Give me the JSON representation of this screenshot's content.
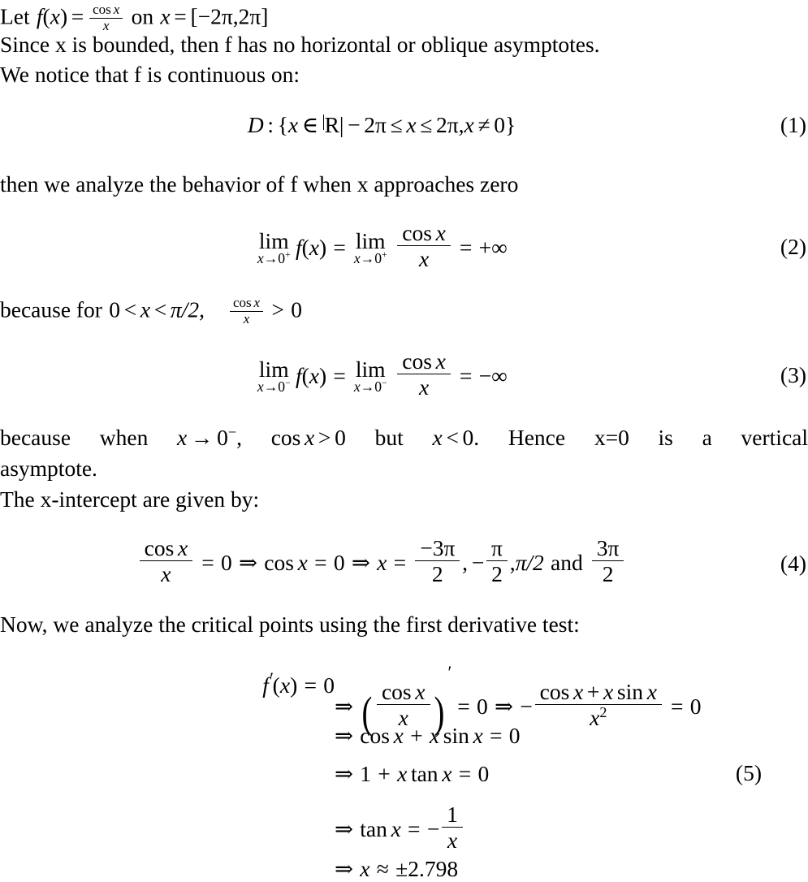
{
  "document": {
    "type": "latex-math-derivation",
    "topic": "Analysis of f(x) = cos(x)/x on [-2pi, 2pi]",
    "background_color": "#ffffff",
    "text_color": "#000000"
  },
  "lines": {
    "intro_let": {
      "prefix": "Let",
      "function_name": "f",
      "paren_open": "(",
      "variable": "x",
      "paren_close": ")",
      "equals": "=",
      "numerator": "cos",
      "num_var": "x",
      "denominator": "x",
      "on": "on",
      "domain_var": "x",
      "domain_equals": "=",
      "interval": "[−2π, 2π]",
      "interval_open": "[",
      "interval_low": "−2π",
      "interval_comma": ",",
      "interval_high": "2π",
      "interval_close": "]"
    },
    "bounded": "Since x is bounded, then f has no horizontal or oblique asymptotes.",
    "continuous": "We notice that f is continuous on:",
    "behavior": "then we analyze the behavior of f when x approaches zero",
    "because_for": {
      "text": "because for",
      "zero": "0",
      "lt1": "<",
      "var": "x",
      "lt2": "<",
      "bound": "π/2,",
      "frac_num_op": "cos",
      "frac_num_var": "x",
      "frac_den": "x",
      "gt": ">",
      "zero2": "0"
    },
    "because_when": {
      "w1": "because",
      "w2": "when",
      "var": "x",
      "arrow": "→",
      "zero_minus_base": "0",
      "zero_minus_sup": "−",
      "comma": ",",
      "cos": "cos",
      "cos_var": "x",
      "gt": ">",
      "zero": "0",
      "but": "but",
      "var2": "x",
      "lt": "<",
      "zero2": "0.",
      "hence": "Hence",
      "xeq0": "x=0",
      "is_a": "is",
      "a": "a",
      "vertical": "vertical"
    },
    "asymptote": "asymptote.",
    "xintercept": "The x-intercept are given by:",
    "critical": "Now, we analyze the critical points using the first derivative test:"
  },
  "equations": [
    {
      "tag": "(1)",
      "id": "domain-set",
      "parts": {
        "D": "D",
        "colon": ":",
        "brace_open": "{",
        "x": "x",
        "in": "∈",
        "reals": "ℝ",
        "bar": "|",
        "minus": "−",
        "two_pi": "2π",
        "le1": "≤",
        "x2": "x",
        "le2": "≤",
        "two_pi2": "2π",
        "comma": ",",
        "x3": "x",
        "neq": "≠",
        "zero": "0",
        "brace_close": "}"
      }
    },
    {
      "tag": "(2)",
      "id": "limit-right",
      "parts": {
        "lim1": "lim",
        "lim1_sub_var": "x",
        "lim1_sub_arrow": "→",
        "lim1_sub_val": "0",
        "lim1_sub_sign": "+",
        "f": "f",
        "fopen": "(",
        "fvar": "x",
        "fclose": ")",
        "eq1": "=",
        "lim2": "lim",
        "lim2_sub_var": "x",
        "lim2_sub_arrow": "→",
        "lim2_sub_val": "0",
        "lim2_sub_sign": "+",
        "num_op": "cos",
        "num_var": "x",
        "den": "x",
        "eq2": "=",
        "result": "+∞"
      }
    },
    {
      "tag": "(3)",
      "id": "limit-left",
      "parts": {
        "lim1": "lim",
        "lim1_sub_var": "x",
        "lim1_sub_arrow": "→",
        "lim1_sub_val": "0",
        "lim1_sub_sign": "−",
        "f": "f",
        "fopen": "(",
        "fvar": "x",
        "fclose": ")",
        "eq1": "=",
        "lim2": "lim",
        "lim2_sub_var": "x",
        "lim2_sub_arrow": "→",
        "lim2_sub_val": "0",
        "lim2_sub_sign": "−",
        "num_op": "cos",
        "num_var": "x",
        "den": "x",
        "eq2": "=",
        "result": "−∞"
      }
    },
    {
      "tag": "(4)",
      "id": "x-intercepts",
      "parts": {
        "num_op": "cos",
        "num_var": "x",
        "den": "x",
        "eq1": "=",
        "zero1": "0",
        "implies1": "⇒",
        "cos": "cos",
        "cos_var": "x",
        "eq2": "=",
        "zero2": "0",
        "implies2": "⇒",
        "x": "x",
        "eq3": "=",
        "r1_num": "−3π",
        "r1_den": "2",
        "comma1": ",",
        "minus": "−",
        "r2_num": "π",
        "r2_den": "2",
        "comma2": ",",
        "r3": "π/2",
        "and": "and",
        "r4_num": "3π",
        "r4_den": "2"
      }
    },
    {
      "tag": "(5)",
      "id": "critical-points",
      "lines": [
        {
          "lhs": {
            "f": "f",
            "prime": "′",
            "open": "(",
            "var": "x",
            "close": ")",
            "eq": "=",
            "zero": "0"
          },
          "rhs": {
            "implies1": "⇒",
            "paren_open": "(",
            "num_op": "cos",
            "num_var": "x",
            "den": "x",
            "paren_close": ")",
            "deriv_prime": "′",
            "eq1": "=",
            "zero1": "0",
            "implies2": "⇒",
            "neg": "−",
            "frac_num": "cos x + x sin x",
            "frac_num_cos": "cos",
            "frac_num_cosvar": "x",
            "frac_num_plus": "+",
            "frac_num_xvar": "x",
            "frac_num_sin": "sin",
            "frac_num_sinvar": "x",
            "frac_den_var": "x",
            "frac_den_pow": "2",
            "eq2": "=",
            "zero2": "0"
          }
        },
        {
          "rhs": {
            "implies": "⇒",
            "cos": "cos",
            "cos_var": "x",
            "plus": "+",
            "xvar": "x",
            "sin": "sin",
            "sin_var": "x",
            "eq": "=",
            "zero": "0"
          }
        },
        {
          "rhs": {
            "implies": "⇒",
            "one": "1",
            "plus": "+",
            "xvar": "x",
            "tan": "tan",
            "tan_var": "x",
            "eq": "=",
            "zero": "0"
          }
        },
        {
          "rhs": {
            "implies": "⇒",
            "tan": "tan",
            "tan_var": "x",
            "eq": "=",
            "neg": "−",
            "frac_num": "1",
            "frac_den": "x"
          }
        },
        {
          "rhs": {
            "implies": "⇒",
            "xvar": "x",
            "approx": "≈",
            "value": "±2.798"
          }
        }
      ]
    }
  ]
}
